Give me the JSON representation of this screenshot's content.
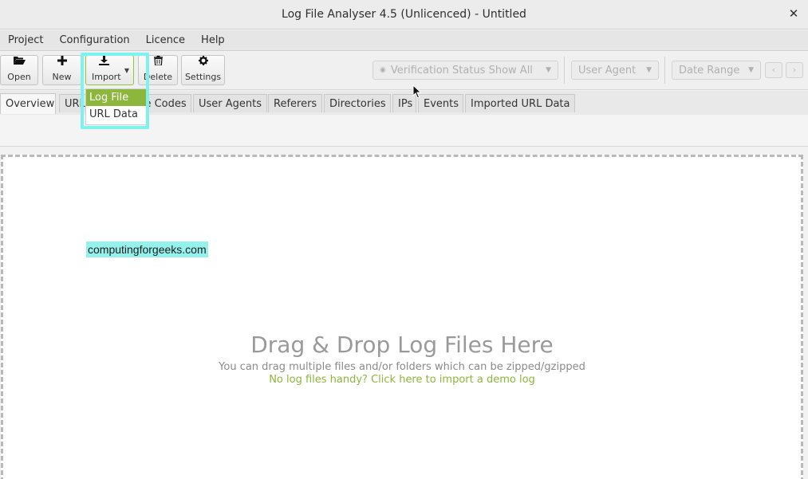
{
  "window": {
    "title": "Log File Analyser 4.5 (Unlicenced) - Untitled",
    "close_glyph": "✕"
  },
  "menubar": {
    "items": [
      "Project",
      "Configuration",
      "Licence",
      "Help"
    ]
  },
  "toolbar": {
    "open_label": "Open",
    "new_label": "New",
    "import_label": "Import",
    "delete_label": "Delete",
    "settings_label": "Settings",
    "verification_label": "Verification Status Show All",
    "user_agent_label": "User Agent",
    "date_range_label": "Date Range",
    "prev_glyph": "‹",
    "next_glyph": "›"
  },
  "import_menu": {
    "items": [
      "Log File",
      "URL Data"
    ],
    "selected_index": 0
  },
  "tabs": [
    "Overview",
    "URLs",
    "Response Codes",
    "User Agents",
    "Referers",
    "Directories",
    "IPs",
    "Events",
    "Imported URL Data"
  ],
  "active_tab": "Overview",
  "watermark": "computingforgeeks.com",
  "dropzone": {
    "title": "Drag & Drop Log Files Here",
    "subtitle": "You can drag multiple files and/or folders which can be zipped/gzipped",
    "link": "No log files handy? Click here to import a demo log"
  },
  "colors": {
    "accent_green": "#8cb63c",
    "highlight_cyan": "#7df2ee"
  }
}
